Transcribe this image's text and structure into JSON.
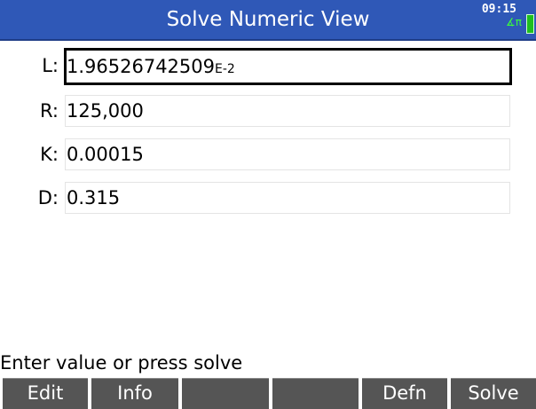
{
  "header": {
    "title": "Solve Numeric View",
    "time": "09:15",
    "angle_indicator": "∡π"
  },
  "variables": [
    {
      "name": "L:",
      "value": "1.96526742509",
      "exponent": "E-2",
      "selected": true
    },
    {
      "name": "R:",
      "value": "125,000"
    },
    {
      "name": "K:",
      "value": "0.00015"
    },
    {
      "name": "D:",
      "value": "0.315"
    }
  ],
  "status": {
    "message": "Enter value or press solve"
  },
  "softkeys": [
    {
      "label": "Edit"
    },
    {
      "label": "Info"
    },
    {
      "label": ""
    },
    {
      "label": ""
    },
    {
      "label": "Defn"
    },
    {
      "label": "Solve"
    }
  ],
  "colors": {
    "titlebar": "#2f58b7",
    "softkey": "#555555",
    "battery": "#1ebf1e"
  }
}
